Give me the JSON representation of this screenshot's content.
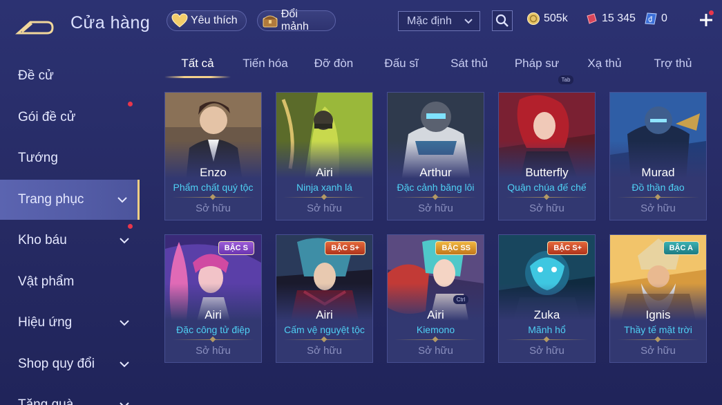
{
  "header": {
    "title": "Cửa hàng",
    "favorites_label": "Yêu thích",
    "fragments_label": "Đổi mảnh",
    "sort_value": "Mặc định",
    "gold": "505k",
    "rubies": "15 345",
    "vouchers": "0"
  },
  "sidebar": {
    "items": [
      {
        "label": "Đề cử"
      },
      {
        "label": "Gói đề cử"
      },
      {
        "label": "Tướng"
      },
      {
        "label": "Trang phục"
      },
      {
        "label": "Kho báu"
      },
      {
        "label": "Vật phẩm"
      },
      {
        "label": "Hiệu ứng"
      },
      {
        "label": "Shop quy đổi"
      },
      {
        "label": "Tặng quà"
      }
    ]
  },
  "tabs": [
    {
      "label": "Tất cả"
    },
    {
      "label": "Tiến hóa"
    },
    {
      "label": "Đỡ đòn"
    },
    {
      "label": "Đấu sĩ"
    },
    {
      "label": "Sát thủ"
    },
    {
      "label": "Pháp sư"
    },
    {
      "label": "Xạ thủ"
    },
    {
      "label": "Trợ thủ"
    }
  ],
  "hints": {
    "tab": "Tab",
    "ctrl": "Ctrl"
  },
  "cards": [
    {
      "hero": "Enzo",
      "skin": "Phẩm chất quý tộc",
      "status": "Sở hữu",
      "badge": ""
    },
    {
      "hero": "Airi",
      "skin": "Ninja xanh lá",
      "status": "Sở hữu",
      "badge": ""
    },
    {
      "hero": "Arthur",
      "skin": "Đặc cảnh băng lôi",
      "status": "Sở hữu",
      "badge": ""
    },
    {
      "hero": "Butterfly",
      "skin": "Quận chúa đế chế",
      "status": "Sở hữu",
      "badge": ""
    },
    {
      "hero": "Murad",
      "skin": "Đồ thần đao",
      "status": "Sở hữu",
      "badge": ""
    },
    {
      "hero": "Airi",
      "skin": "Đặc công tử điệp",
      "status": "Sở hữu",
      "badge": "BẬC S"
    },
    {
      "hero": "Airi",
      "skin": "Cấm vệ nguyệt tộc",
      "status": "Sở hữu",
      "badge": "BẬC S+"
    },
    {
      "hero": "Airi",
      "skin": "Kiemono",
      "status": "Sở hữu",
      "badge": "BẬC SS"
    },
    {
      "hero": "Zuka",
      "skin": "Mãnh hổ",
      "status": "Sở hữu",
      "badge": "BẬC S+"
    },
    {
      "hero": "Ignis",
      "skin": "Thầy tế mặt trời",
      "status": "Sở hữu",
      "badge": "BẬC A"
    }
  ],
  "colors": {
    "accent_gold": "#f3d18c",
    "skin_name": "#4fd0f4",
    "notification": "#e9364b"
  }
}
